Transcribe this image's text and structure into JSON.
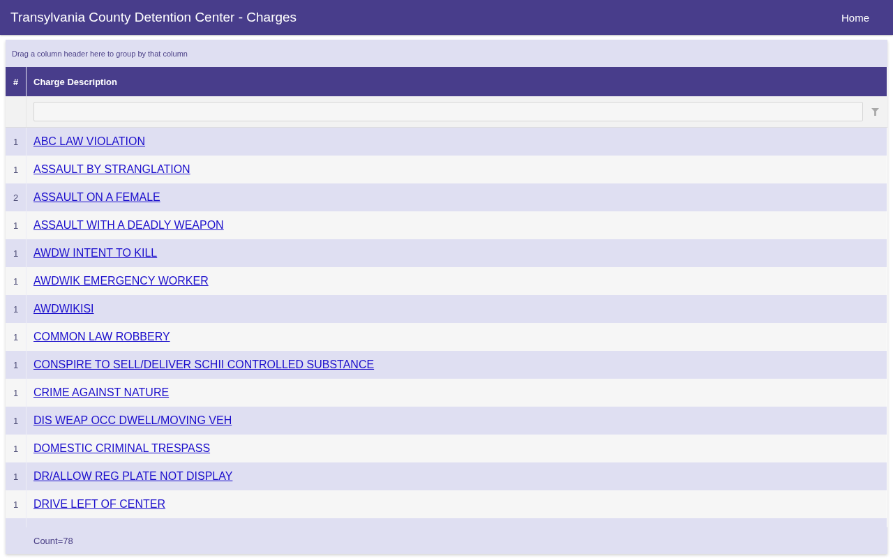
{
  "app_bar": {
    "title": "Transylvania County Detention Center - Charges",
    "nav_links": [
      "Home"
    ]
  },
  "grid": {
    "group_panel": {
      "hint": "Drag a column header here to group by that column"
    },
    "columns": [
      "#",
      "Charge Description"
    ],
    "rows": [
      {
        "count": "1",
        "charge": "ABC LAW VIOLATION"
      },
      {
        "count": "1",
        "charge": "ASSAULT BY STRANGLATION"
      },
      {
        "count": "2",
        "charge": "ASSAULT ON A FEMALE"
      },
      {
        "count": "1",
        "charge": "ASSAULT WITH A DEADLY WEAPON"
      },
      {
        "count": "1",
        "charge": "AWDW INTENT TO KILL"
      },
      {
        "count": "1",
        "charge": "AWDWIK EMERGENCY WORKER"
      },
      {
        "count": "1",
        "charge": "AWDWIKISI"
      },
      {
        "count": "1",
        "charge": "COMMON LAW ROBBERY"
      },
      {
        "count": "1",
        "charge": "CONSPIRE TO SELL/DELIVER SCHII CONTROLLED SUBSTANCE"
      },
      {
        "count": "1",
        "charge": "CRIME AGAINST NATURE"
      },
      {
        "count": "1",
        "charge": "DIS WEAP OCC DWELL/MOVING VEH"
      },
      {
        "count": "1",
        "charge": "DOMESTIC CRIMINAL TRESPASS"
      },
      {
        "count": "1",
        "charge": "DR/ALLOW REG PLATE NOT DISPLAY"
      },
      {
        "count": "1",
        "charge": "DRIVE LEFT OF CENTER"
      }
    ],
    "footer": {
      "aggregate": "Count=78"
    }
  }
}
